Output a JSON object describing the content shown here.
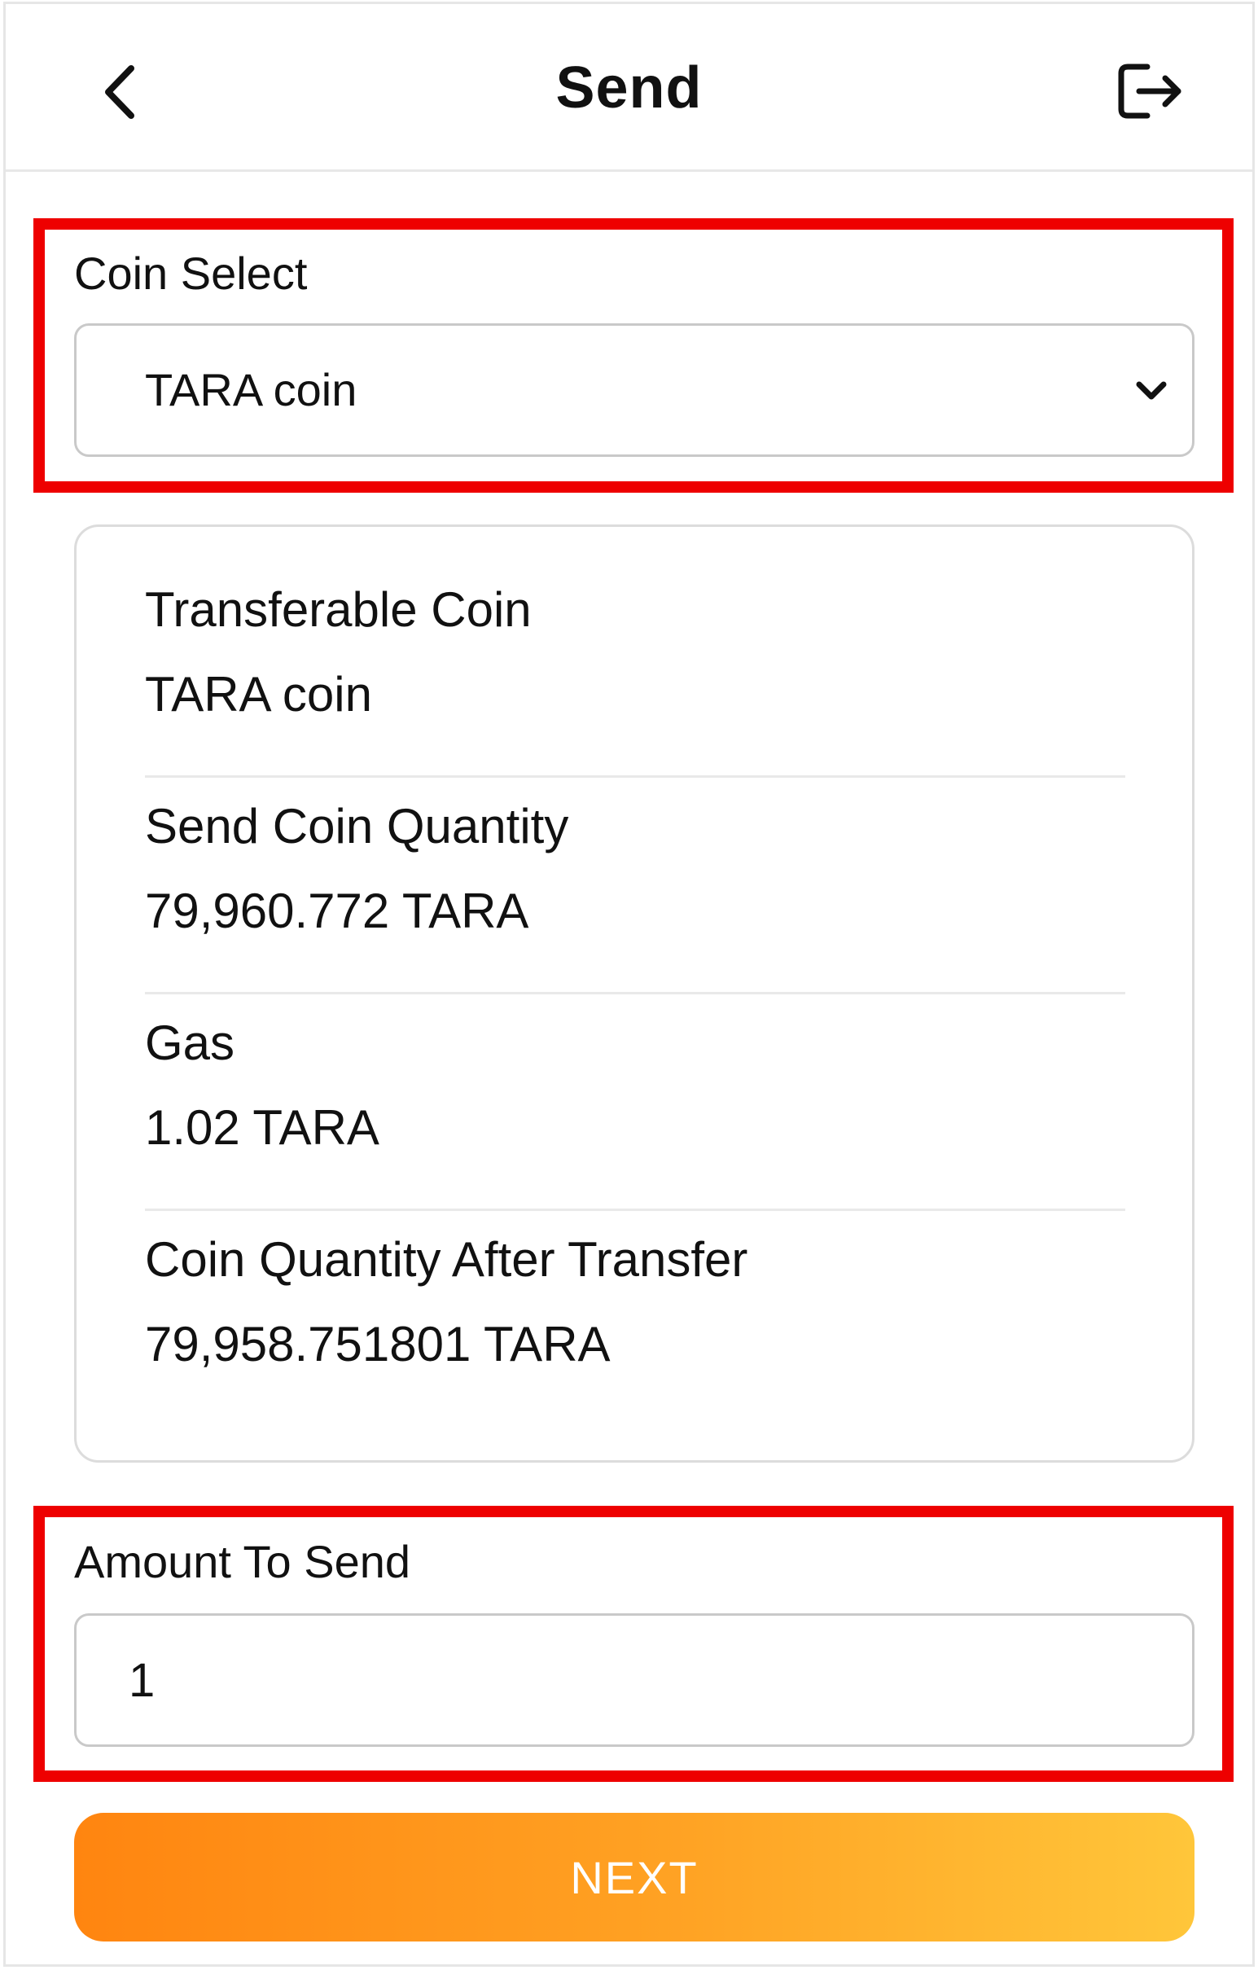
{
  "header": {
    "title": "Send",
    "back_icon": "chevron-left-icon",
    "logout_icon": "logout-icon"
  },
  "coin_select": {
    "label": "Coin Select",
    "selected_value": "TARA coin",
    "chevron_icon": "chevron-down-icon"
  },
  "info": {
    "rows": [
      {
        "label": "Transferable Coin",
        "value": "TARA coin"
      },
      {
        "label": "Send Coin Quantity",
        "value": "79,960.772 TARA"
      },
      {
        "label": "Gas",
        "value": "1.02 TARA"
      },
      {
        "label": "Coin Quantity After Transfer",
        "value": "79,958.751801 TARA"
      }
    ]
  },
  "amount": {
    "label": "Amount To Send",
    "value": "1"
  },
  "actions": {
    "next_label": "NEXT"
  },
  "colors": {
    "highlight": "#ee0000",
    "button_gradient_start": "#ff8510",
    "button_gradient_end": "#ffc63a"
  }
}
